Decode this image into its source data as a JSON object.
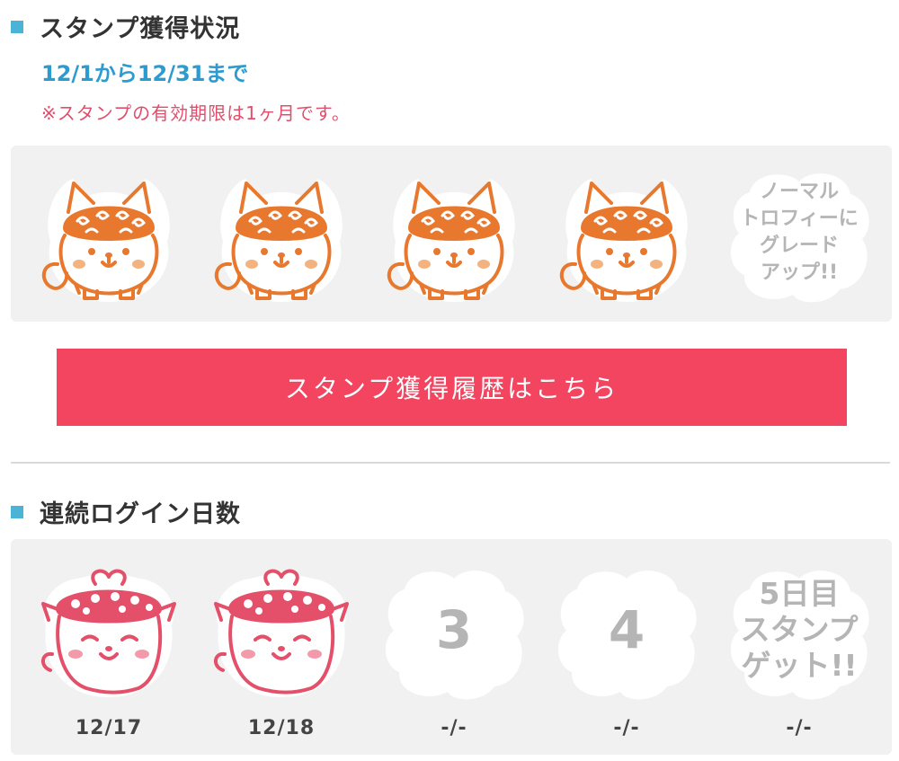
{
  "stamp_section": {
    "title": "スタンプ獲得状況",
    "period": "12/1から12/31まで",
    "note": "※スタンプの有効期限は1ヶ月です。",
    "stamps": [
      {
        "state": "earned",
        "icon": "fox-mascot-stamp-icon"
      },
      {
        "state": "earned",
        "icon": "fox-mascot-stamp-icon"
      },
      {
        "state": "earned",
        "icon": "fox-mascot-stamp-icon"
      },
      {
        "state": "earned",
        "icon": "fox-mascot-stamp-icon"
      },
      {
        "state": "goal",
        "text": "ノーマル\nトロフィーに\nグレード\nアップ!!"
      }
    ],
    "stamp_color": "#e8782e",
    "history_button": "スタンプ獲得履歴はこちら",
    "button_color": "#f34560"
  },
  "login_section": {
    "title": "連続ログイン日数",
    "days": [
      {
        "state": "earned",
        "icon": "cat-mascot-stamp-icon",
        "date": "12/17"
      },
      {
        "state": "earned",
        "icon": "cat-mascot-stamp-icon",
        "date": "12/18"
      },
      {
        "state": "empty",
        "number": "3",
        "date": "-/-"
      },
      {
        "state": "empty",
        "number": "4",
        "date": "-/-"
      },
      {
        "state": "goal",
        "text": "5日目\nスタンプ\nゲット!!",
        "date": "-/-"
      }
    ],
    "stamp_color": "#e4506a"
  },
  "colors": {
    "accent_blue": "#2b9bd0",
    "section_marker": "#4ab3d6",
    "note_red": "#e24d6c",
    "panel_gray": "#f1f1f1",
    "placeholder_gray": "#b5b5b5"
  }
}
